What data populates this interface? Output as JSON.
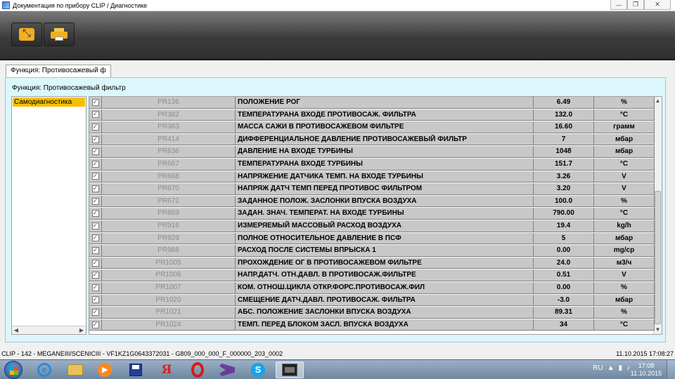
{
  "window": {
    "title": "Документация по прибору CLIP / Диагностике",
    "controls": [
      "—",
      "❐",
      "✕"
    ]
  },
  "toolbar": {
    "buttons": [
      "fullscreen-icon",
      "printer-icon"
    ]
  },
  "tab": {
    "label": "Функция: Противосажевый ф"
  },
  "main": {
    "function_title": "Функция: Противосажевый фильтр",
    "left_items": [
      "Самодиагностика"
    ],
    "rows": [
      {
        "code": "PR136",
        "name": "ПОЛОЖЕНИЕ РОГ",
        "value": "6.49",
        "unit": "%"
      },
      {
        "code": "PR382",
        "name": "ТЕМПЕРАТУРАНА ВХОДЕ ПРОТИВОСАЖ. ФИЛЬТРА",
        "value": "132.0",
        "unit": "°C"
      },
      {
        "code": "PR383",
        "name": "МАССА САЖИ В ПРОТИВОСАЖЕВОМ ФИЛЬТРЕ",
        "value": "16.60",
        "unit": "грамм"
      },
      {
        "code": "PR414",
        "name": "ДИФФЕРЕНЦИАЛЬНОЕ ДАВЛЕНИЕ ПРОТИВОСАЖЕВЫЙ ФИЛЬТР",
        "value": "7",
        "unit": "мбар"
      },
      {
        "code": "PR636",
        "name": "ДАВЛЕНИЕ НА ВХОДЕ ТУРБИНЫ",
        "value": "1048",
        "unit": "мбар"
      },
      {
        "code": "PR667",
        "name": "ТЕМПЕРАТУРАНА ВХОДЕ ТУРБИНЫ",
        "value": "151.7",
        "unit": "°C"
      },
      {
        "code": "PR668",
        "name": "НАПРЯЖЕНИЕ ДАТЧИКА ТЕМП. НА ВХОДЕ ТУРБИНЫ",
        "value": "3.26",
        "unit": "V"
      },
      {
        "code": "PR670",
        "name": "НАПРЯЖ ДАТЧ ТЕМП ПЕРЕД ПРОТИВОС ФИЛЬТРОМ",
        "value": "3.20",
        "unit": "V"
      },
      {
        "code": "PR672",
        "name": "ЗАДАННОЕ ПОЛОЖ. ЗАСЛОНКИ ВПУСКА ВОЗДУХА",
        "value": "100.0",
        "unit": "%"
      },
      {
        "code": "PR889",
        "name": "ЗАДАН. ЗНАЧ. ТЕМПЕРАТ. НА ВХОДЕ ТУРБИНЫ",
        "value": "790.00",
        "unit": "°C"
      },
      {
        "code": "PR916",
        "name": "ИЗМЕРЯЕМЫЙ МАССОВЫЙ РАСХОД ВОЗДУХА",
        "value": "19.4",
        "unit": "kg/h"
      },
      {
        "code": "PR929",
        "name": "ПОЛНОЕ ОТНОСИТЕЛЬНОЕ ДАВЛЕНИЕ В ПСФ",
        "value": "5",
        "unit": "мбар"
      },
      {
        "code": "PR988",
        "name": "РАСХОД ПОСЛЕ СИСТЕМЫ ВПРЫСКА 1",
        "value": "0.00",
        "unit": "mg/cp"
      },
      {
        "code": "PR1005",
        "name": "ПРОХОЖДЕНИЕ ОГ В ПРОТИВОСАЖЕВОМ ФИЛЬТРЕ",
        "value": "24.0",
        "unit": "м3/ч"
      },
      {
        "code": "PR1006",
        "name": "НАПР.ДАТЧ. ОТН.ДАВЛ. В ПРОТИВОСАЖ.ФИЛЬТРЕ",
        "value": "0.51",
        "unit": "V"
      },
      {
        "code": "PR1007",
        "name": "КОМ. ОТНОШ.ЦИКЛА ОТКР.ФОРС.ПРОТИВОСАЖ.ФИЛ",
        "value": "0.00",
        "unit": "%"
      },
      {
        "code": "PR1020",
        "name": "СМЕЩЕНИЕ ДАТЧ.ДАВЛ. ПРОТИВОСАЖ. ФИЛЬТРА",
        "value": "-3.0",
        "unit": "мбар"
      },
      {
        "code": "PR1021",
        "name": "АБС. ПОЛОЖЕНИЕ ЗАСЛОНКИ ВПУСКА ВОЗДУХА",
        "value": "89.31",
        "unit": "%"
      },
      {
        "code": "PR1024",
        "name": "ТЕМП. ПЕРЕД БЛОКОМ ЗАСЛ. ВПУСКА ВОЗДУХА",
        "value": "34",
        "unit": "°C"
      }
    ],
    "check_mark": "✓"
  },
  "status": {
    "left": "CLIP - 142 - MEGANEIII/SCENICIII - VF1KZ1G0643372031 - G809_000_000_F_000000_203_0002",
    "right": "11.10.2015 17:08:27"
  },
  "taskbar": {
    "apps": [
      "ie-icon",
      "folder-icon",
      "media-player-icon",
      "save-icon",
      "yandex-icon",
      "opera-icon",
      "visual-studio-icon",
      "skype-icon",
      "clip-app-icon"
    ],
    "yandex_glyph": "Я",
    "ie_glyph": "e",
    "skype_glyph": "S",
    "lang": "RU",
    "time": "17:08",
    "date": "11.10.2015"
  },
  "colors": {
    "selected_item": "#f6c000",
    "panel_bg": "#dcf7fb",
    "toolbar_icon": "#f0b020"
  }
}
